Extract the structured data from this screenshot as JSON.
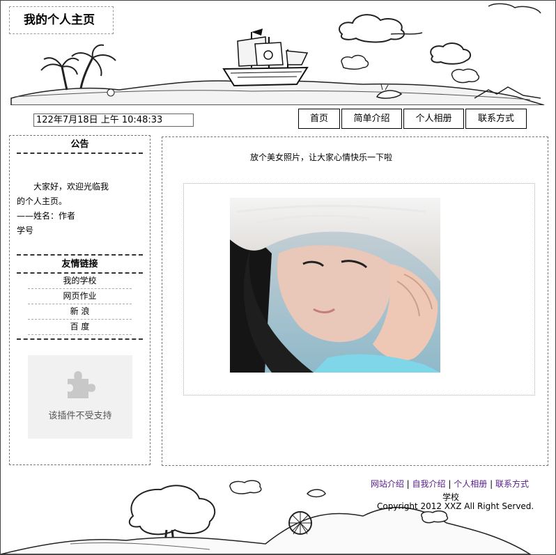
{
  "header": {
    "site_title": "我的个人主页"
  },
  "clock": {
    "text": "122年7月18日 上午 10:48:33"
  },
  "nav": {
    "items": [
      "首页",
      "简单介绍",
      "个人相册",
      "联系方式"
    ]
  },
  "sidebar": {
    "notice_title": "公告",
    "notice_lines": [
      "大家好，欢迎光临我",
      "的个人主页。",
      "——姓名：作者",
      "学号"
    ],
    "links_title": "友情链接",
    "links": [
      "我的学校",
      "网页作业",
      "新 浪",
      "百 度"
    ],
    "plugin_text": "该插件不受支持",
    "plugin_icon": "puzzle-piece-icon"
  },
  "main": {
    "caption": "放个美女照片，让大家心情快乐一下啦"
  },
  "footer": {
    "links": [
      "网站介绍",
      "自我介绍",
      "个人相册",
      "联系方式"
    ],
    "separator": "|",
    "school": "学校",
    "copyright": "Copyright 2012 XXZ All Right Served."
  }
}
